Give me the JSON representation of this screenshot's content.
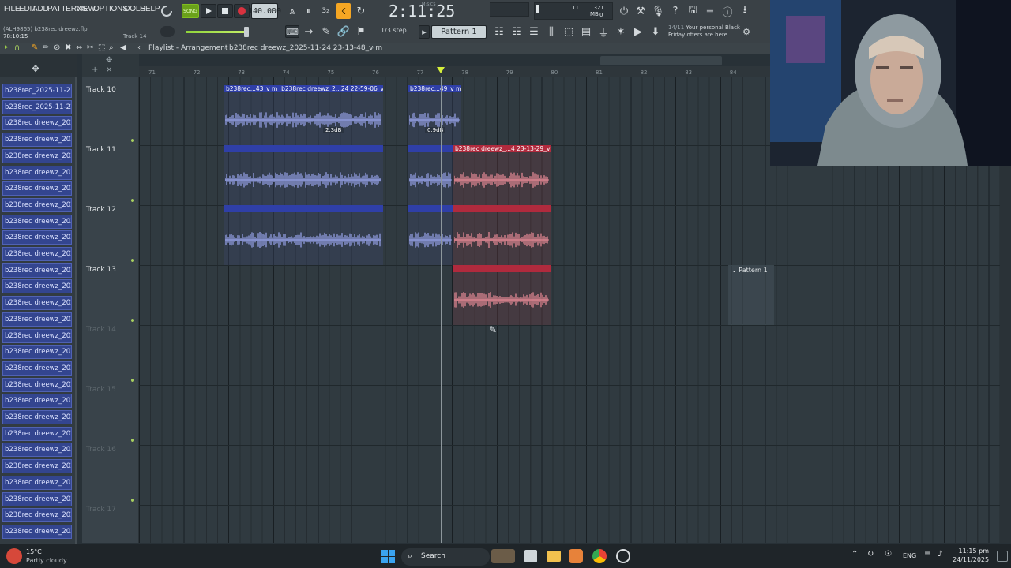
{
  "menu": [
    "FILE",
    "EDIT",
    "ADD",
    "PATTERNS",
    "VIEW",
    "OPTIONS",
    "TOOLS",
    "HELP"
  ],
  "transport": {
    "song_label": "SONG",
    "tempo": "140.000",
    "time": "2:11:25",
    "time_unit": "M:S:CS",
    "cpu": "11",
    "mem": "1321 MB",
    "mem_sub": "0"
  },
  "project": {
    "file": "(ALH9865) b238rec dreewz.flp",
    "position": "78:10:15",
    "hint_track": "Track 14"
  },
  "toolbar": {
    "step": "1/3 step",
    "pattern": "Pattern 1",
    "news_count": "14/11",
    "news_text": "Your personal Black Friday offers are here"
  },
  "playlist": {
    "title": "Playlist - Arrangement",
    "selected": "b238rec dreewz_2025-11-24 23-13-48_v m"
  },
  "ruler": [
    "71",
    "72",
    "73",
    "74",
    "75",
    "76",
    "77",
    "78",
    "79",
    "80",
    "81",
    "82",
    "83",
    "84"
  ],
  "browser_items": [
    "b238rec_2025-11-22 06-...",
    "b238rec_2025-11-22 06-...",
    "b238rec dreewz_2025-11...",
    "b238rec dreewz_2025-11...",
    "b238rec dreewz_2025-11...",
    "b238rec dreewz_2025-11...",
    "b238rec dreewz_2025-11...",
    "b238rec dreewz_2025-11...",
    "b238rec dreewz_2025-11...",
    "b238rec dreewz_2025-11...",
    "b238rec dreewz_2025-11...",
    "b238rec dreewz_2025-11...",
    "b238rec dreewz_2025-11...",
    "b238rec dreewz_2025-11...",
    "b238rec dreewz_2025-11...",
    "b238rec dreewz_2025-11...",
    "b238rec dreewz_2025-11...",
    "b238rec dreewz_2025-11...",
    "b238rec dreewz_2025-11...",
    "b238rec dreewz_2025-11...",
    "b238rec dreewz_2025-11...",
    "b238rec dreewz_2025-11...",
    "b238rec dreewz_2025-11...",
    "b238rec dreewz_2025-11...",
    "b238rec dreewz_2025-11...",
    "b238rec dreewz_2025-11...",
    "b238rec dreewz_2025-11...",
    "b238rec dreewz_2025-11..."
  ],
  "tracks": [
    "Track 10",
    "Track 11",
    "Track 12",
    "Track 13",
    "Track 14",
    "Track 15",
    "Track 16",
    "Track 17"
  ],
  "clips": {
    "c1": "b238rec...43_v m",
    "c2": "b238rec dreewz_2...24 22-59-06_v m",
    "c3": "b238rec...49_v m",
    "c4": "b238rec dreewz_...4 23-13-29_v m",
    "gain1": "2.3dB",
    "gain2": "0.9dB",
    "pattern": "Pattern 1"
  },
  "taskbar": {
    "temp": "15°C",
    "weather": "Partly cloudy",
    "search": "Search",
    "lang": "ENG",
    "time": "11:15 pm",
    "date": "24/11/2025"
  },
  "colors": {
    "clip_blue": "#2f3fa8",
    "clip_red": "#b02a3d",
    "wave_blue": "#9aa6ee",
    "wave_red": "#ee8e9a",
    "accent": "#f5a623"
  }
}
